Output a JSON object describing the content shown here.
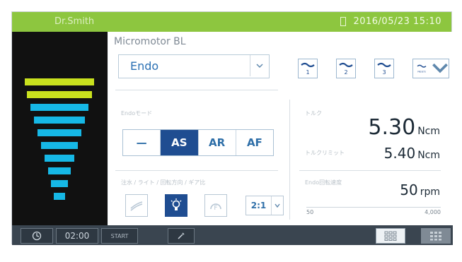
{
  "header": {
    "user": "Dr.Smith",
    "datetime": "2016/05/23 15:10",
    "accent_color": "#8dc63f"
  },
  "main": {
    "title": "Micromotor BL",
    "mode_select": {
      "value": "Endo"
    },
    "presets": [
      {
        "label": "1"
      },
      {
        "label": "2"
      },
      {
        "label": "3"
      },
      {
        "label": "PRESETS"
      }
    ],
    "endo_mode_label": "Endoモード",
    "endo_modes": [
      {
        "label": "—",
        "active": false
      },
      {
        "label": "AS",
        "active": true
      },
      {
        "label": "AR",
        "active": false
      },
      {
        "label": "AF",
        "active": false
      }
    ],
    "torque_label": "トルク",
    "torque_value": "5.30",
    "torque_unit": "Ncm",
    "torque_limit_label": "トルクリミット",
    "torque_limit_value": "5.40",
    "torque_limit_unit": "Ncm",
    "settings_label": "注水 / ライト / 回転方向 / ギア比",
    "speed_label": "Endo回転速度",
    "speed_value": "50",
    "speed_unit": "rpm",
    "speed_scale_min": "50",
    "speed_scale_max": "4,000",
    "gear_ratio": "2:1"
  },
  "icons": {
    "dropdown": "chevron-down-icon",
    "water": "water-spray-icon",
    "light": "light-bulb-icon",
    "rotation": "rotation-icon",
    "timer": "timer-icon",
    "tool": "tool-icon",
    "grid": "grid-icon",
    "expand": "chevron-down-icon"
  },
  "footer": {
    "time": "02:00",
    "start_label": "START"
  },
  "colors": {
    "primary": "#1f4d91",
    "bar_yellow": "#c9e11e",
    "bar_cyan": "#16b8e6",
    "panel_bg": "#111111"
  }
}
